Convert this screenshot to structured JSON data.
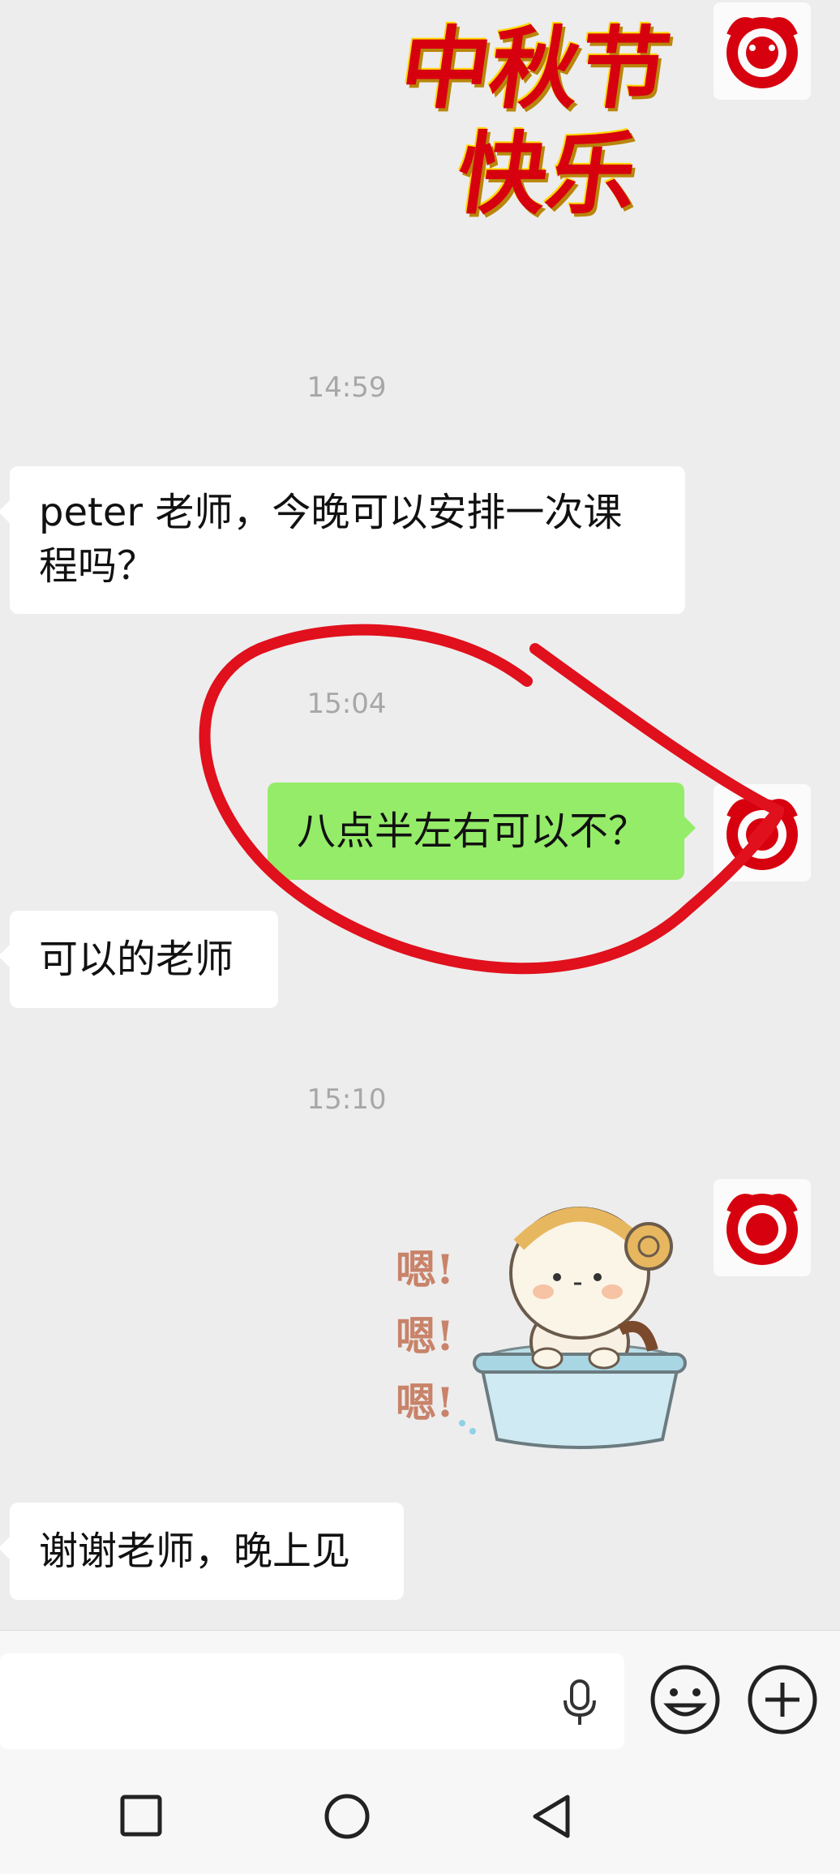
{
  "chat": {
    "sticker_top_text": [
      "中秋节",
      "快乐"
    ],
    "times": [
      "14:59",
      "15:04",
      "15:10"
    ],
    "msg1": "peter 老师，今晚可以安排一次课\n程吗？",
    "msg2": "八点半左右可以不？",
    "msg3": "可以的老师",
    "sticker2_text": [
      "嗯!",
      "嗯!",
      "嗯!"
    ],
    "msg4": "谢谢老师，晚上见"
  },
  "input": {
    "placeholder": ""
  },
  "colors": {
    "background": "#ededed",
    "sent_bubble": "#95ec69",
    "received_bubble": "#ffffff",
    "annotation": "#e0101c",
    "sticker_red": "#d7000f"
  },
  "icons": {
    "voice": "microphone-icon",
    "emoji": "smiley-icon",
    "more": "plus-circle-icon",
    "nav_recent": "square-icon",
    "nav_home": "circle-icon",
    "nav_back": "triangle-back-icon"
  }
}
